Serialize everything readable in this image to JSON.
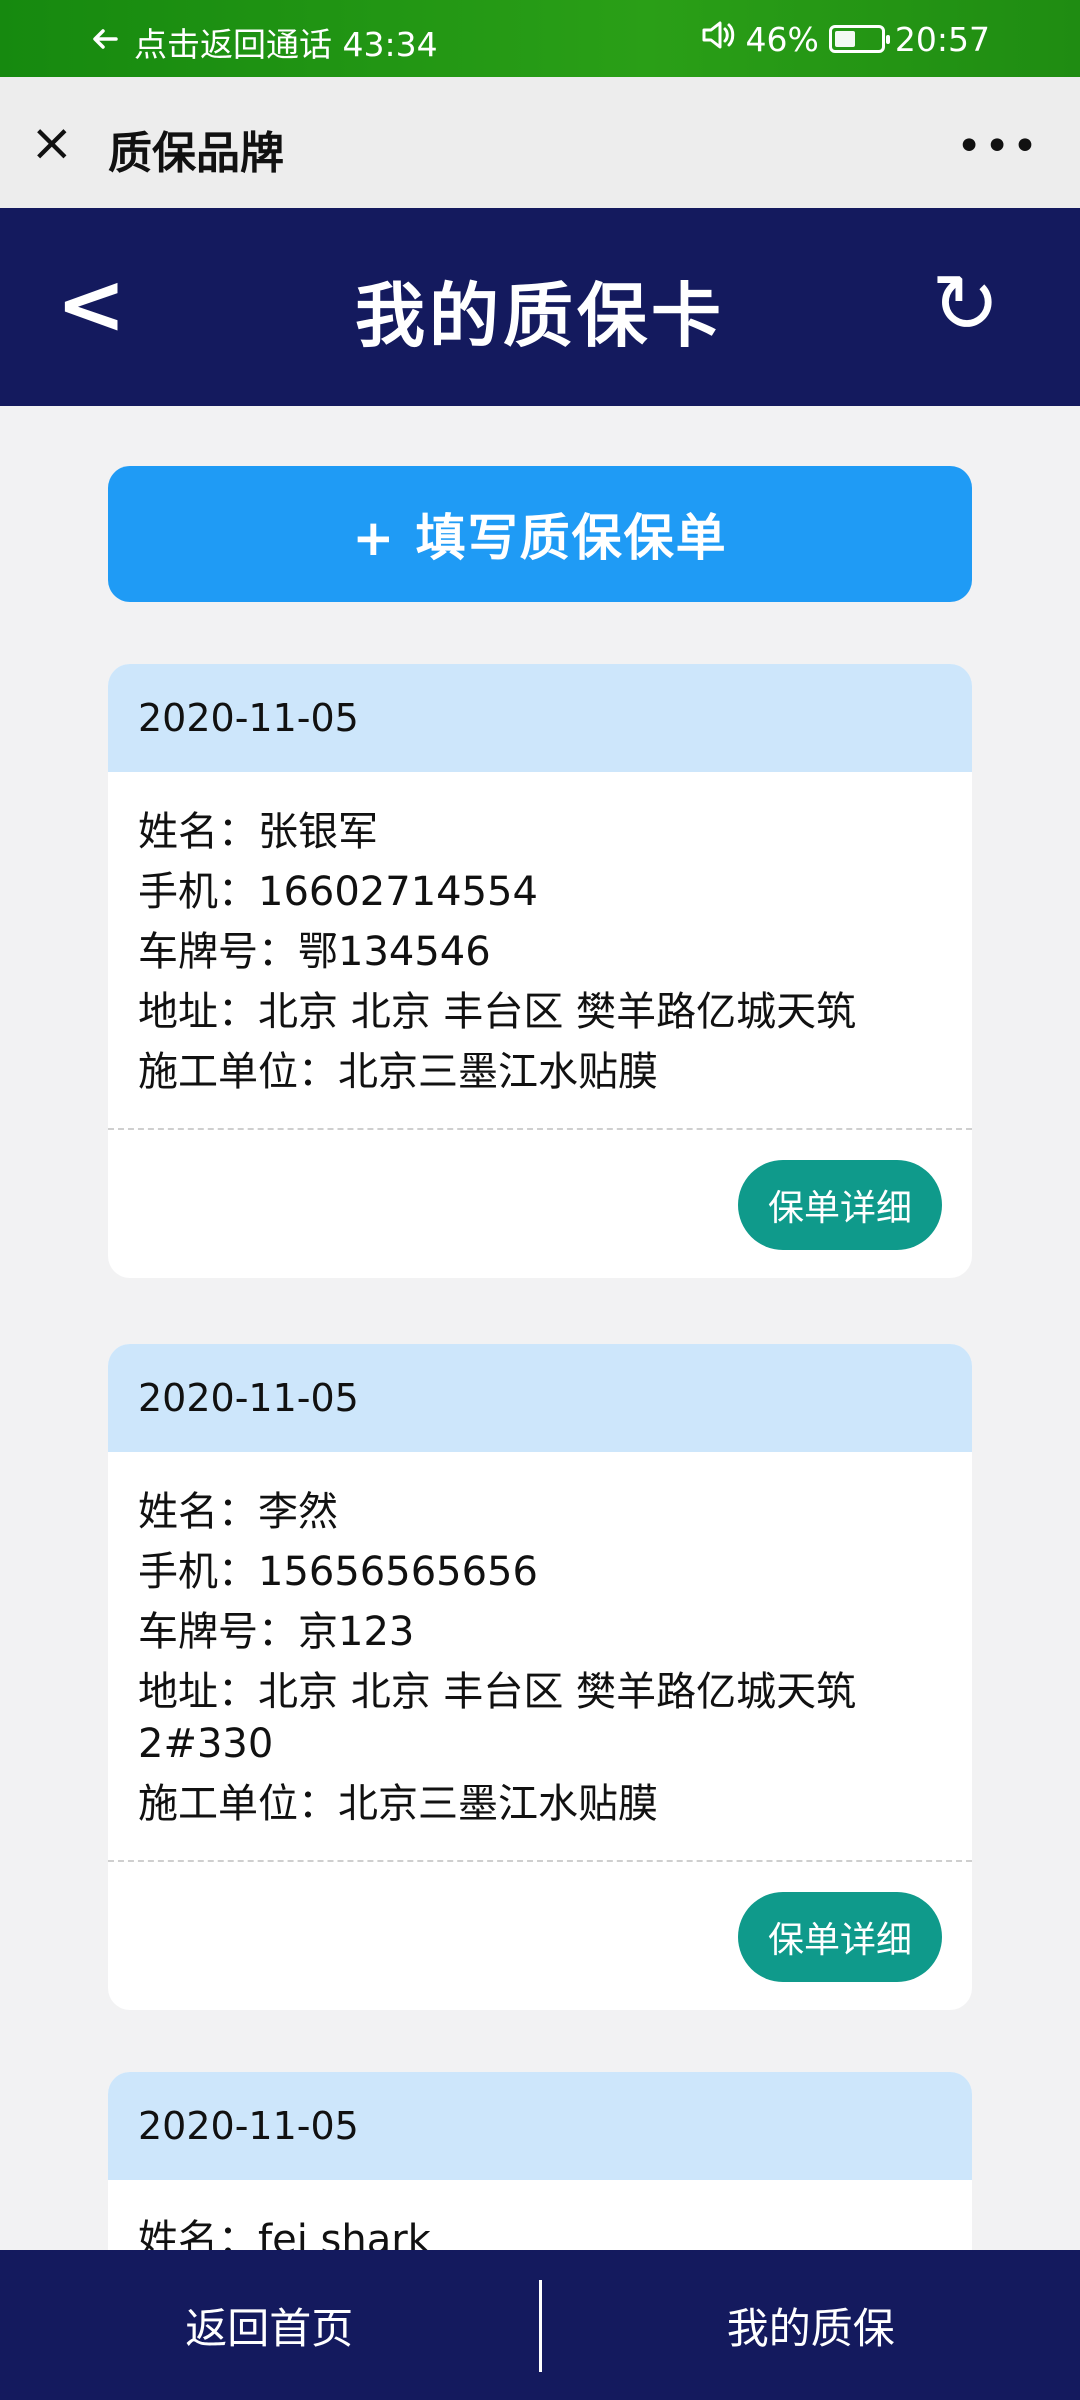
{
  "status_bar": {
    "back_call_text": "点击返回通话 43:34",
    "battery_text": "46%",
    "battery_level": 0.46,
    "time": "20:57",
    "icons": [
      "arrow-left-icon",
      "volume-icon",
      "battery-icon"
    ]
  },
  "webview": {
    "title": "质保品牌",
    "close_icon": "×",
    "more_icon": "•••"
  },
  "header": {
    "back_icon": "<",
    "title": "我的质保卡",
    "refresh_icon": "↻"
  },
  "add_button": {
    "label": "+ 填写质保保单"
  },
  "cards": [
    {
      "date": "2020-11-05",
      "name": "姓名：张银军",
      "phone": "手机：16602714554",
      "plate": "车牌号：鄂134546",
      "address": "地址：北京 北京 丰台区 樊羊路亿城天筑",
      "company": "施工单位：北京三墨江水贴膜",
      "detail_button": "保单详细"
    },
    {
      "date": "2020-11-05",
      "name": "姓名：李然",
      "phone": "手机：15656565656",
      "plate": "车牌号：京123",
      "address": "地址：北京 北京 丰台区 樊羊路亿城天筑 2#330",
      "company": "施工单位：北京三墨江水贴膜",
      "detail_button": "保单详细"
    },
    {
      "date": "2020-11-05",
      "name": "姓名：fei shark"
    }
  ],
  "bottom_nav": {
    "home": "返回首页",
    "mine": "我的质保"
  },
  "colors": {
    "status_bar": "#1f8c12",
    "header": "#141a5e",
    "add_button": "#1f9bf5",
    "card_date_bg": "#cde6fb",
    "detail_button": "#0f9a8b"
  }
}
